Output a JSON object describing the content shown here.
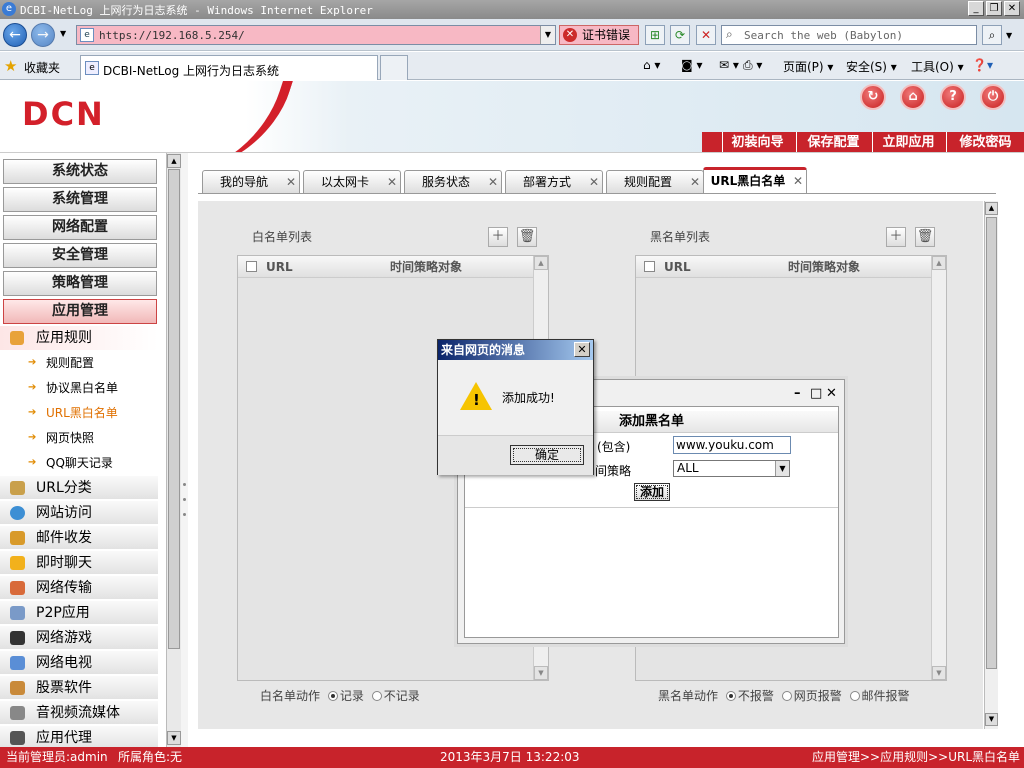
{
  "browser": {
    "title": "DCBI-NetLog 上网行为日志系统 - Windows Internet Explorer",
    "address": "https://192.168.5.254/",
    "cert_error": "证书错误",
    "search_placeholder": "Search the web (Babylon)",
    "favorites": "收藏夹",
    "tab_title": "DCBI-NetLog 上网行为日志系统",
    "cmd_page": "页面(P)",
    "cmd_safety": "安全(S)",
    "cmd_tools": "工具(O)"
  },
  "header": {
    "logo": "DCN",
    "buttons": [
      "初装向导",
      "保存配置",
      "立即应用",
      "修改密码"
    ]
  },
  "nav": {
    "menus": [
      "系统状态",
      "系统管理",
      "网络配置",
      "安全管理",
      "策略管理",
      "应用管理"
    ],
    "group": "应用规则",
    "subitems": [
      "规则配置",
      "协议黑白名单",
      "URL黑白名单",
      "网页快照",
      "QQ聊天记录"
    ],
    "items": [
      "URL分类",
      "网站访问",
      "邮件收发",
      "即时聊天",
      "网络传输",
      "P2P应用",
      "网络游戏",
      "网络电视",
      "股票软件",
      "音视频流媒体",
      "应用代理"
    ]
  },
  "tabs": [
    "我的导航",
    "以太网卡",
    "服务状态",
    "部署方式",
    "规则配置",
    "URL黑白名单"
  ],
  "whitelist": {
    "title": "白名单列表",
    "col_url": "URL",
    "col_policy": "时间策略对象",
    "action_label": "白名单动作",
    "opt_record": "记录",
    "opt_norecord": "不记录"
  },
  "blacklist": {
    "title": "黑名单列表",
    "col_url": "URL",
    "col_policy": "时间策略对象",
    "action_label": "黑名单动作",
    "opt_noalarm": "不报警",
    "opt_webalarm": "网页报警",
    "opt_mailalarm": "邮件报警"
  },
  "add_dialog": {
    "title": "添加黑名单",
    "url_label": "(包含)",
    "url_value": "www.youku.com",
    "policy_label": "间策略",
    "policy_value": "ALL",
    "submit": "添加"
  },
  "alert": {
    "title": "来自网页的消息",
    "message": "添加成功!",
    "ok": "确定"
  },
  "status": {
    "user": "当前管理员:admin",
    "role": "所属角色:无",
    "datetime": "2013年3月7日 13:22:03",
    "path": "应用管理>>应用规则>>URL黑白名单"
  },
  "colors": {
    "brand_red": "#c8232b",
    "current_nav": "#e07000"
  }
}
